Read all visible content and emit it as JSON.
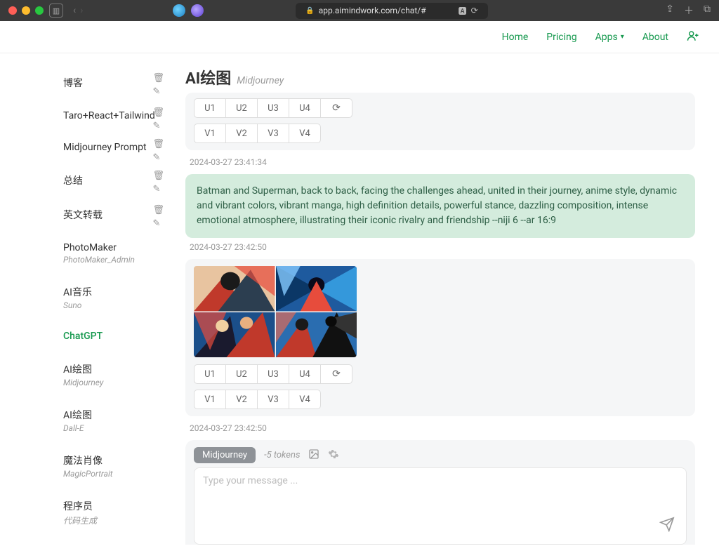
{
  "browser": {
    "url": "app.aimindwork.com/chat/#"
  },
  "nav": {
    "home": "Home",
    "pricing": "Pricing",
    "apps": "Apps",
    "about": "About"
  },
  "sidebar": {
    "items": [
      {
        "title": "博客",
        "sub": "",
        "actions": true
      },
      {
        "title": "Taro+React+Tailwind",
        "sub": "",
        "actions": true
      },
      {
        "title": "Midjourney Prompt",
        "sub": "",
        "actions": true
      },
      {
        "title": "总结",
        "sub": "",
        "actions": true
      },
      {
        "title": "英文转载",
        "sub": "",
        "actions": true
      },
      {
        "title": "PhotoMaker",
        "sub": "PhotoMaker_Admin",
        "actions": false
      },
      {
        "title": "AI音乐",
        "sub": "Suno",
        "actions": false
      },
      {
        "title": "ChatGPT",
        "sub": "",
        "actions": false,
        "active": true
      },
      {
        "title": "AI绘图",
        "sub": "Midjourney",
        "actions": false
      },
      {
        "title": "AI绘图",
        "sub": "Dall-E",
        "actions": false
      },
      {
        "title": "魔法肖像",
        "sub": "MagicPortrait",
        "actions": false
      },
      {
        "title": "程序员",
        "sub": "代码生成",
        "actions": false
      }
    ]
  },
  "panel": {
    "title": "AI绘图",
    "model": "Midjourney"
  },
  "buttons": {
    "u": [
      "U1",
      "U2",
      "U3",
      "U4"
    ],
    "v": [
      "V1",
      "V2",
      "V3",
      "V4"
    ],
    "refresh": "⟳"
  },
  "timestamps": {
    "t1": "2024-03-27 23:41:34",
    "t2": "2024-03-27 23:42:50",
    "t3": "2024-03-27 23:42:50"
  },
  "prompt": "Batman and Superman, back to back, facing the challenges ahead, united in their journey, anime style, dynamic and vibrant colors, vibrant manga, high definition details, powerful stance, dazzling composition, intense emotional atmosphere, illustrating their iconic rivalry and friendship --niji 6 --ar 16:9",
  "composer": {
    "tag": "Midjourney",
    "tokens": "-5 tokens",
    "placeholder": "Type your message ..."
  }
}
